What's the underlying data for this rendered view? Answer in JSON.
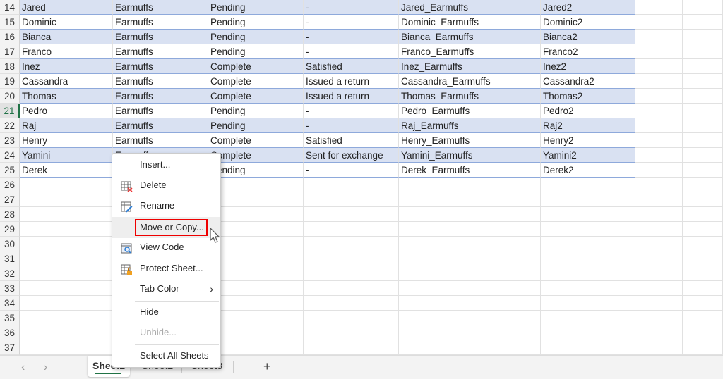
{
  "rows": [
    {
      "n": "14",
      "cells": [
        "Jared",
        "Earmuffs",
        "Pending",
        "-",
        "Jared_Earmuffs",
        "Jared2"
      ]
    },
    {
      "n": "15",
      "cells": [
        "Dominic",
        "Earmuffs",
        "Pending",
        "-",
        "Dominic_Earmuffs",
        "Dominic2"
      ]
    },
    {
      "n": "16",
      "cells": [
        "Bianca",
        "Earmuffs",
        "Pending",
        "-",
        "Bianca_Earmuffs",
        "Bianca2"
      ]
    },
    {
      "n": "17",
      "cells": [
        "Franco",
        "Earmuffs",
        "Pending",
        "-",
        "Franco_Earmuffs",
        "Franco2"
      ]
    },
    {
      "n": "18",
      "cells": [
        "Inez",
        "Earmuffs",
        "Complete",
        "Satisfied",
        "Inez_Earmuffs",
        "Inez2"
      ]
    },
    {
      "n": "19",
      "cells": [
        "Cassandra",
        "Earmuffs",
        "Complete",
        "Issued a return",
        "Cassandra_Earmuffs",
        "Cassandra2"
      ]
    },
    {
      "n": "20",
      "cells": [
        "Thomas",
        "Earmuffs",
        "Complete",
        "Issued a return",
        "Thomas_Earmuffs",
        "Thomas2"
      ]
    },
    {
      "n": "21",
      "cells": [
        "Pedro",
        "Earmuffs",
        "Pending",
        "-",
        "Pedro_Earmuffs",
        "Pedro2"
      ]
    },
    {
      "n": "22",
      "cells": [
        "Raj",
        "Earmuffs",
        "Pending",
        "-",
        "Raj_Earmuffs",
        "Raj2"
      ]
    },
    {
      "n": "23",
      "cells": [
        "Henry",
        "Earmuffs",
        "Complete",
        "Satisfied",
        "Henry_Earmuffs",
        "Henry2"
      ]
    },
    {
      "n": "24",
      "cells": [
        "Yamini",
        "Earmuffs",
        "Complete",
        "Sent for exchange",
        "Yamini_Earmuffs",
        "Yamini2"
      ]
    },
    {
      "n": "25",
      "cells": [
        "Derek",
        "Earmuffs",
        "Pending",
        "-",
        "Derek_Earmuffs",
        "Derek2"
      ]
    },
    {
      "n": "26",
      "cells": []
    },
    {
      "n": "27",
      "cells": []
    },
    {
      "n": "28",
      "cells": []
    },
    {
      "n": "29",
      "cells": []
    },
    {
      "n": "30",
      "cells": []
    },
    {
      "n": "31",
      "cells": []
    },
    {
      "n": "32",
      "cells": []
    },
    {
      "n": "33",
      "cells": []
    },
    {
      "n": "34",
      "cells": []
    },
    {
      "n": "35",
      "cells": []
    },
    {
      "n": "36",
      "cells": []
    },
    {
      "n": "37",
      "cells": []
    }
  ],
  "active_row": "21",
  "context_menu": {
    "items": [
      {
        "label": "Insert...",
        "icon": ""
      },
      {
        "label": "Delete",
        "icon": "delete-sheet-icon"
      },
      {
        "label": "Rename",
        "icon": "rename-sheet-icon"
      },
      {
        "label": "Move or Copy...",
        "icon": "",
        "highlighted": true
      },
      {
        "label": "View Code",
        "icon": "view-code-icon"
      },
      {
        "label": "Protect Sheet...",
        "icon": "protect-sheet-icon"
      },
      {
        "label": "Tab Color",
        "icon": "",
        "submenu": true
      },
      {
        "label": "Hide",
        "icon": ""
      },
      {
        "label": "Unhide...",
        "icon": "",
        "disabled": true
      },
      {
        "label": "Select All Sheets",
        "icon": ""
      }
    ],
    "submenu_arrow": "›"
  },
  "tabs": {
    "prev": "‹",
    "next": "›",
    "sheets": [
      "Sheet1",
      "Sheet2",
      "Sheet3"
    ],
    "active": "Sheet1",
    "add": "+"
  },
  "colors": {
    "band": "#d9e1f2",
    "table_border": "#8ea9db",
    "accent": "#217346",
    "highlight_box": "#e00000"
  }
}
